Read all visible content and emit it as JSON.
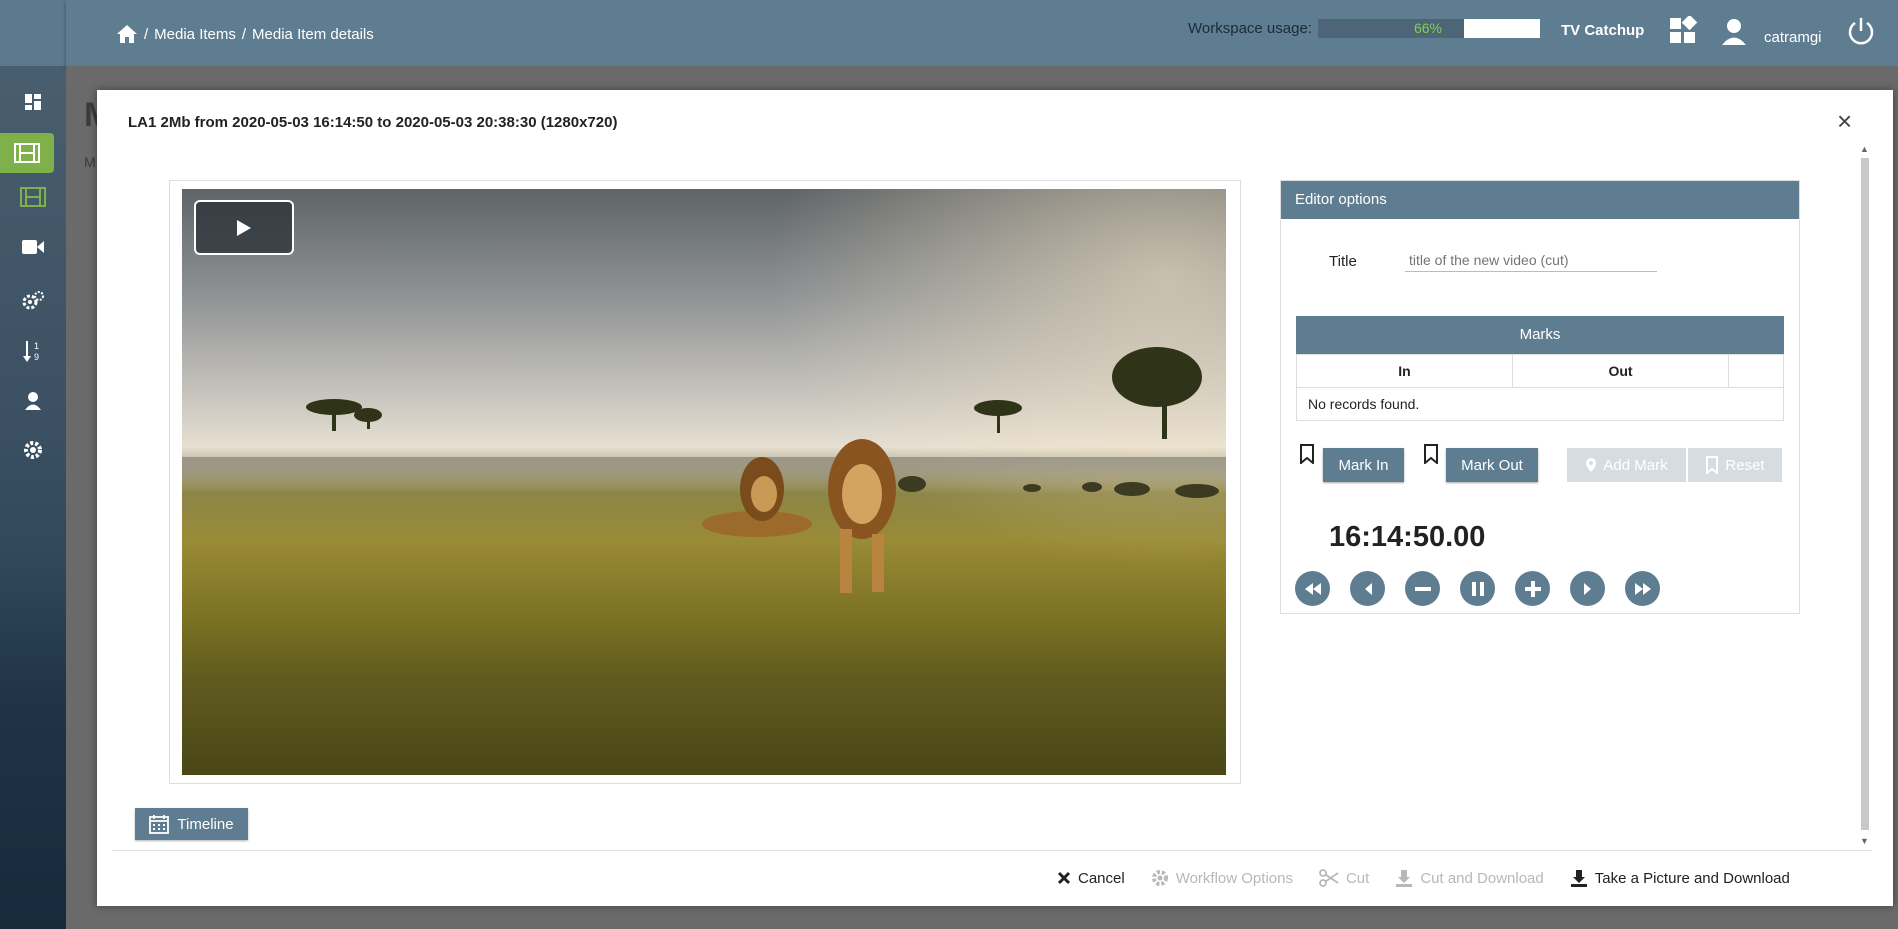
{
  "breadcrumb": {
    "items": [
      "Media Items",
      "Media Item details"
    ]
  },
  "header": {
    "workspace_label": "Workspace usage:",
    "workspace_value": "66%",
    "workspace_fraction": 0.66,
    "channel": "TV Catchup",
    "username": "catramgi"
  },
  "sidebar": {
    "items": [
      "dashboard-icon",
      "film-icon",
      "film-icon",
      "video-camera-icon",
      "gears-icon",
      "sort-numeric-icon",
      "user-icon",
      "settings-icon"
    ]
  },
  "background_page": {
    "title": "M",
    "subtitle": "M"
  },
  "modal": {
    "title": "LA1 2Mb from 2020-05-03 16:14:50 to 2020-05-03 20:38:30 (1280x720)",
    "close": "×",
    "timeline_label": "Timeline"
  },
  "editor": {
    "heading": "Editor options",
    "title_label": "Title",
    "title_placeholder": "title of the new video (cut)",
    "marks_heading": "Marks",
    "col_in": "In",
    "col_out": "Out",
    "empty_text": "No records found.",
    "mark_in": "Mark In",
    "mark_out": "Mark Out",
    "add_mark": "Add Mark",
    "reset": "Reset",
    "timecode": "16:14:50.00"
  },
  "footer": {
    "cancel": "Cancel",
    "workflow_options": "Workflow Options",
    "cut": "Cut",
    "cut_and_download": "Cut and Download",
    "take_picture": "Take a Picture and Download"
  },
  "colors": {
    "accent": "#5f7d91",
    "active": "#7fb14a",
    "usage_text": "#7fd44b"
  }
}
